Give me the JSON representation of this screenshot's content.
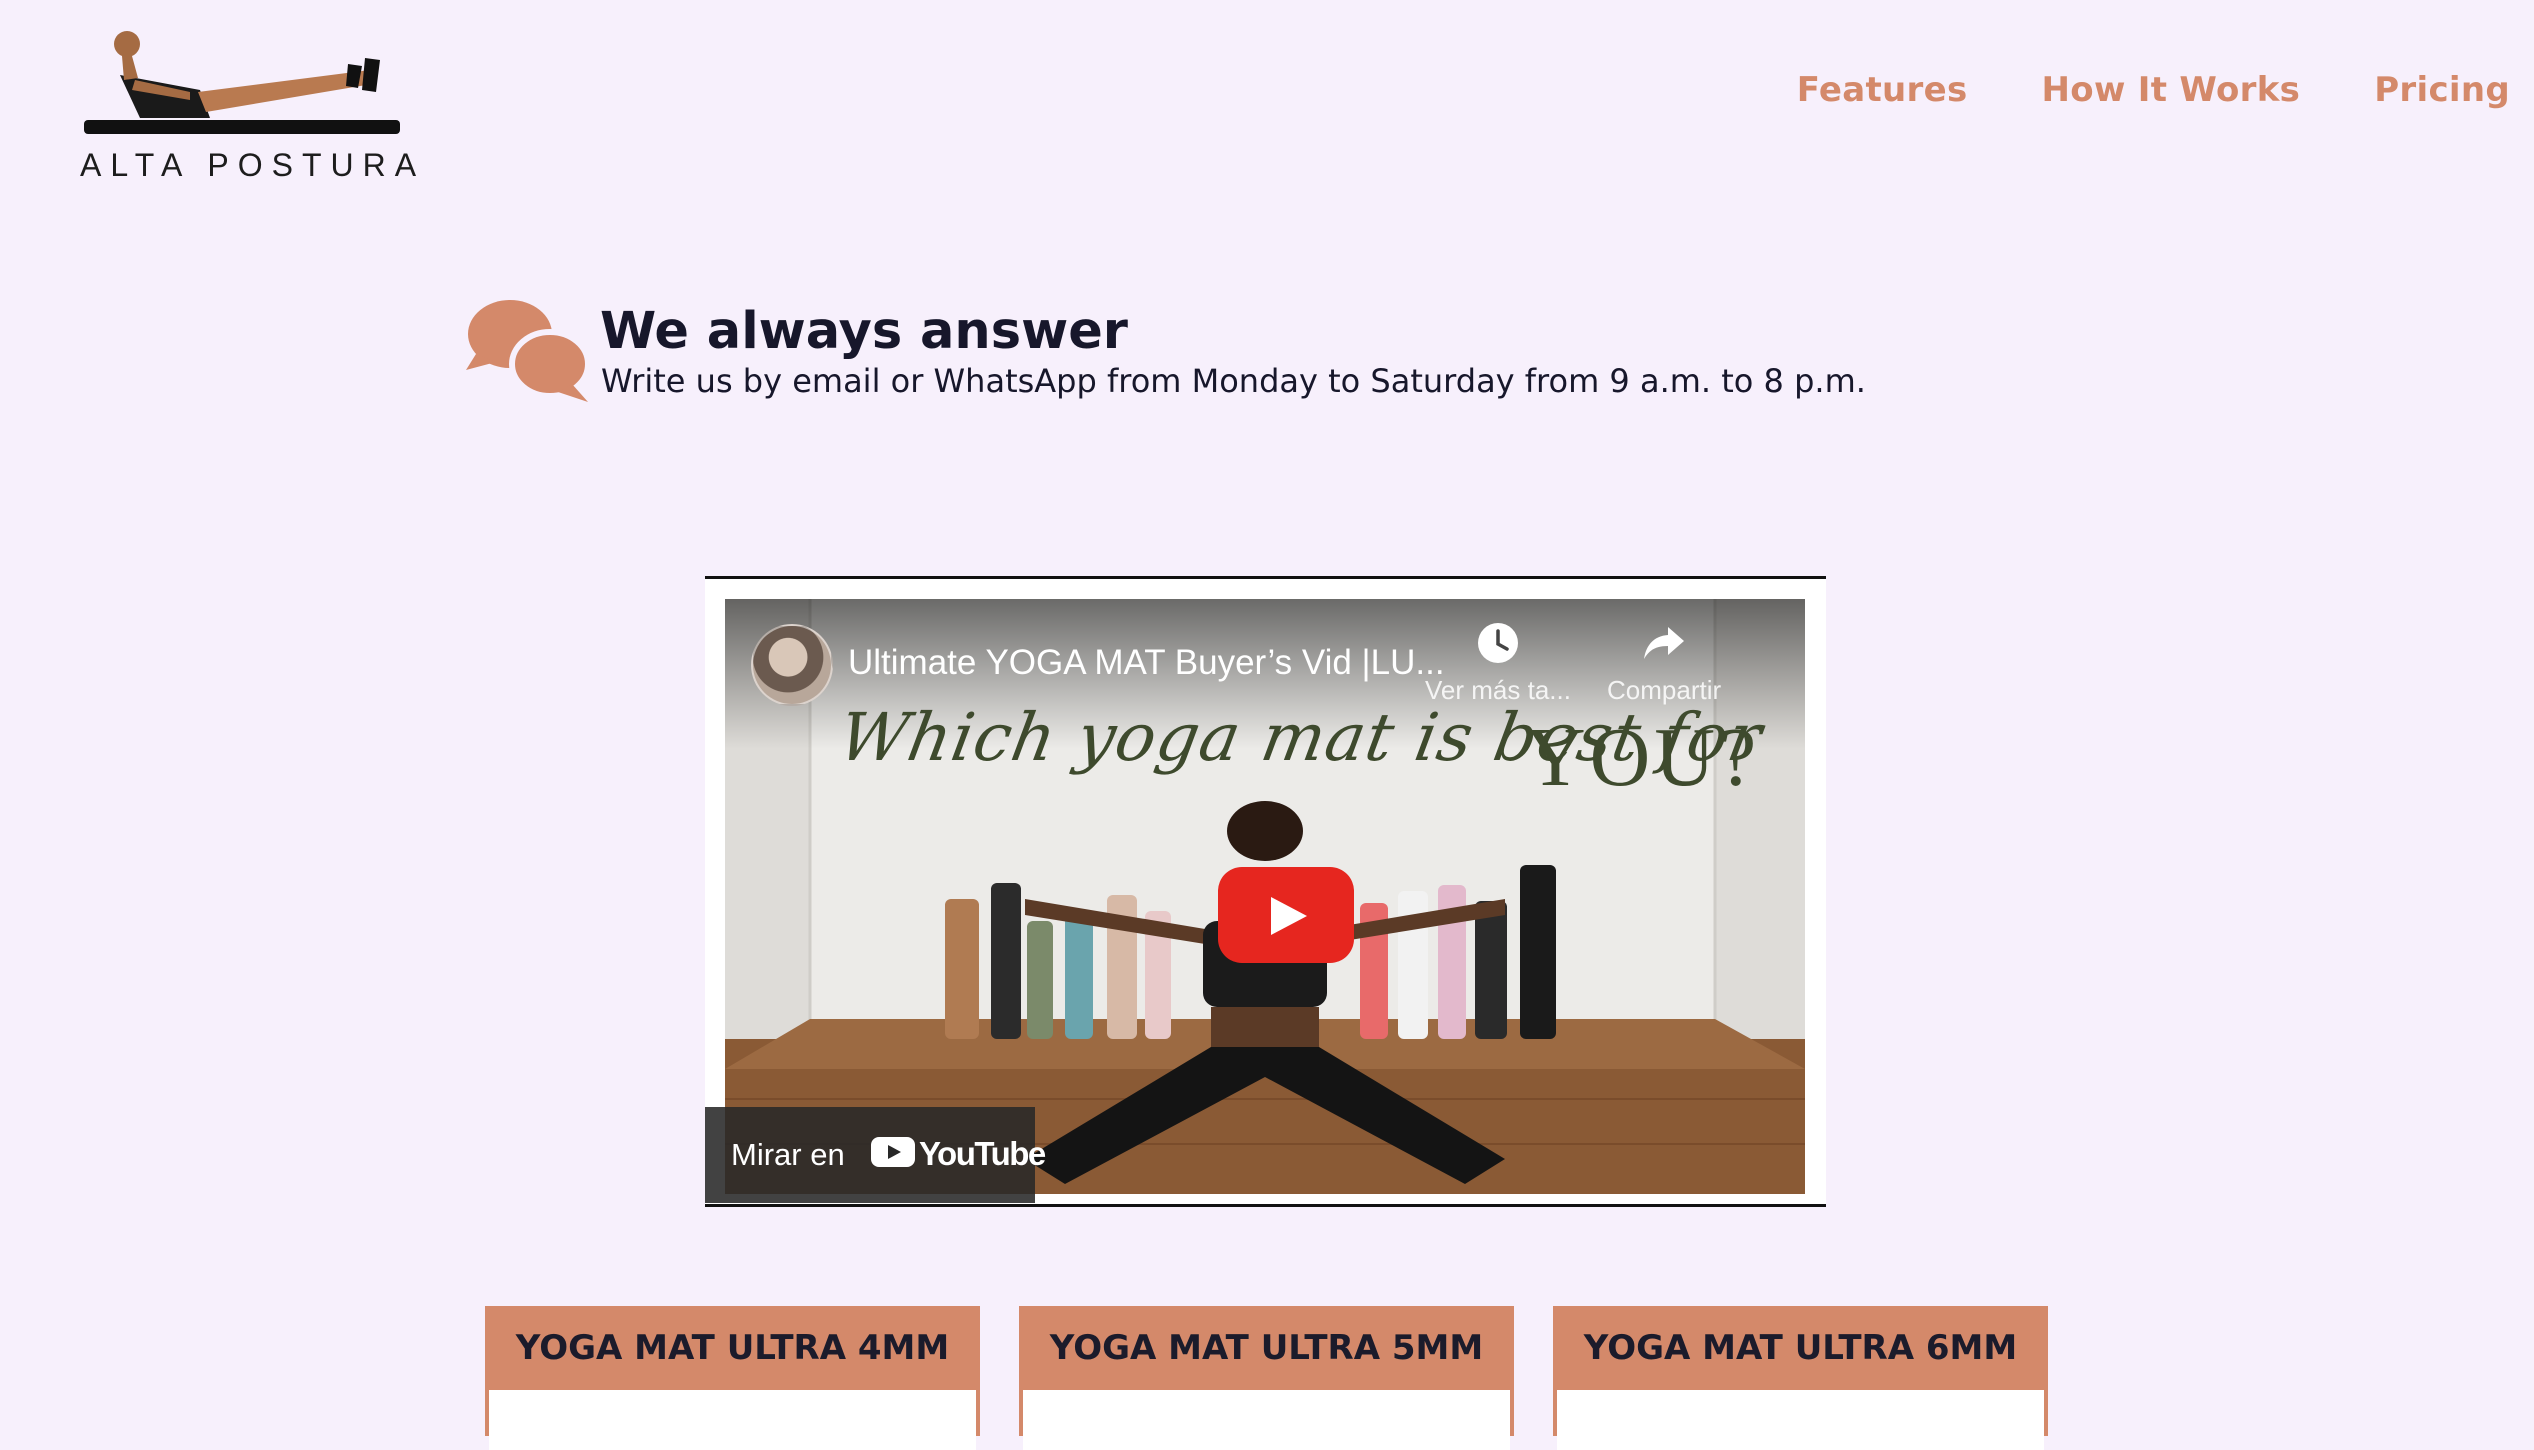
{
  "brand": {
    "name": "ALTA POSTURA",
    "logo_icon": "yoga-pose-logo"
  },
  "nav": {
    "items": [
      "Features",
      "How It Works",
      "Pricing"
    ]
  },
  "support": {
    "icon": "chat-bubbles-icon",
    "title": "We always answer",
    "text": "Write us by email or WhatsApp from Monday to Saturday from 9 a.m. to 8 p.m."
  },
  "video": {
    "title": "Ultimate YOGA MAT Buyer’s Vid |LU...",
    "watch_later": "Ver más ta...",
    "share": "Compartir",
    "overlay_script": "Which yoga mat is best for",
    "overlay_you": "YOU?",
    "watch_on": "Mirar en",
    "youtube": "YouTube"
  },
  "plans": [
    {
      "name": "YOGA MAT ULTRA 4MM"
    },
    {
      "name": "YOGA MAT ULTRA 5MM"
    },
    {
      "name": "YOGA MAT ULTRA 6MM"
    }
  ],
  "colors": {
    "accent": "#d4896a",
    "background": "#f7f0fc",
    "text": "#17172b",
    "youtube_red": "#e6261f"
  }
}
